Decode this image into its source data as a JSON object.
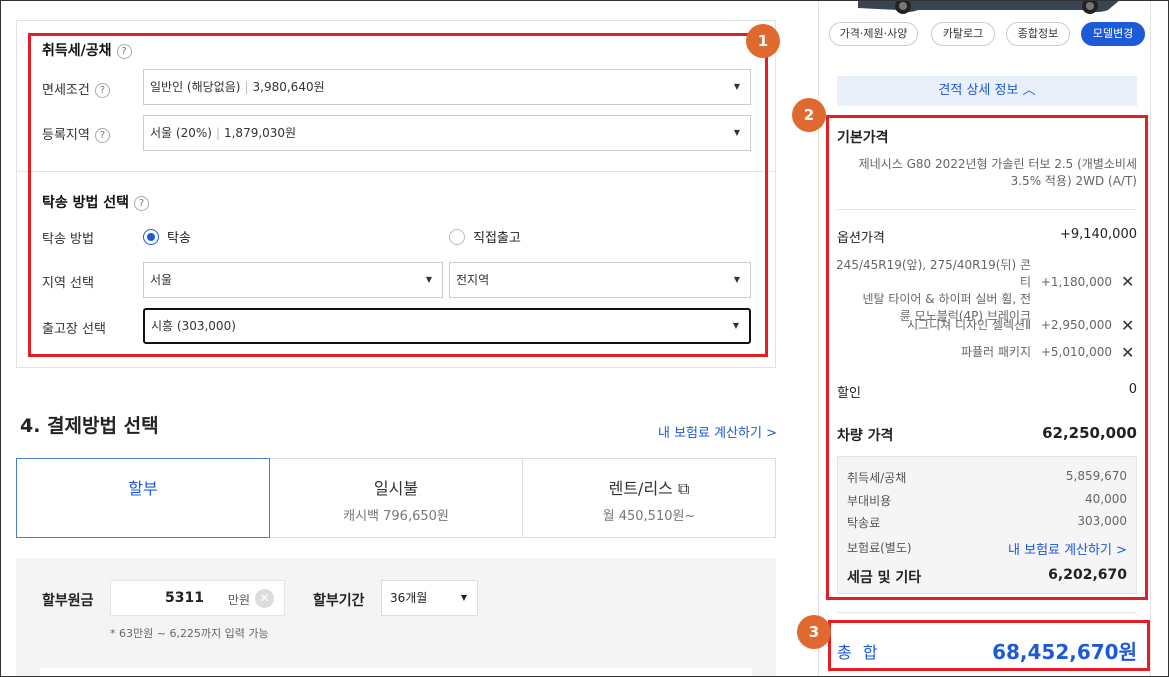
{
  "tax_section": {
    "title": "취득세/공채",
    "help": "?",
    "exemption": {
      "label": "면세조건",
      "value": "일반인 (해당없음)",
      "amount": "3,980,640원"
    },
    "region": {
      "label": "등록지역",
      "value": "서울 (20%)",
      "amount": "1,879,030원"
    }
  },
  "delivery": {
    "title": "탁송 방법 선택",
    "method_label": "탁송 방법",
    "option_delivery": "탁송",
    "option_pickup": "직접출고",
    "region_label": "지역 선택",
    "region_city": "서울",
    "region_district": "전지역",
    "factory_label": "출고장 선택",
    "factory_value": "시흥 (303,000)"
  },
  "payment": {
    "title": "4. 결제방법 선택",
    "calc_link": "내 보험료 계산하기 >",
    "tabs": [
      {
        "title": "할부",
        "sub": ""
      },
      {
        "title": "일시불",
        "sub": "캐시백 796,650원"
      },
      {
        "title": "렌트/리스 ⧉",
        "sub": "월 450,510원~"
      }
    ],
    "principal_label": "할부원금",
    "principal_value": "5311",
    "principal_unit": "만원",
    "period_label": "할부기간",
    "period_value": "36개월",
    "hint": "* 63만원 ~ 6,225까지 입력 가능"
  },
  "right": {
    "chips": [
      "가격·제원·사양",
      "카탈로그",
      "종합정보",
      "모델변경"
    ],
    "detail_toggle": "견적 상세 정보 ︿",
    "base_price_title": "기본가격",
    "base_model_line1": "제네시스 G80 2022년형 가솔린 터보 2.5 (개별소비세",
    "base_model_line2": "3.5% 적용) 2WD (A/T)",
    "option_label": "옵션가격",
    "option_total": "+9,140,000",
    "options": [
      {
        "lines": [
          "245/45R19(앞), 275/40R19(뒤) 콘티",
          "넨탈 타이어 & 하이퍼 실버 휠, 전",
          "륜 모노블럭(4P) 브레이크"
        ],
        "price": "+1,180,000"
      },
      {
        "lines": [
          "시그니쳐 디자인 셀렉션Ⅱ"
        ],
        "price": "+2,950,000"
      },
      {
        "lines": [
          "파퓰러 패키지"
        ],
        "price": "+5,010,000"
      }
    ],
    "discount_label": "할인",
    "discount_value": "0",
    "car_price_label": "차량 가격",
    "car_price_value": "62,250,000",
    "tax_items": [
      {
        "label": "취득세/공채",
        "value": "5,859,670"
      },
      {
        "label": "부대비용",
        "value": "40,000"
      },
      {
        "label": "탁송료",
        "value": "303,000"
      },
      {
        "label": "보험료(별도)",
        "value": "내 보험료 계산하기 >"
      }
    ],
    "tax_total_label": "세금 및 기타",
    "tax_total_value": "6,202,670",
    "grand_total_label": "총 합",
    "grand_total_value": "68,452,670원"
  },
  "badges": [
    "1",
    "2",
    "3"
  ],
  "colors": {
    "accent": "#1c5ad8",
    "highlight_red": "#e31e25",
    "badge_orange": "#e0692f"
  }
}
